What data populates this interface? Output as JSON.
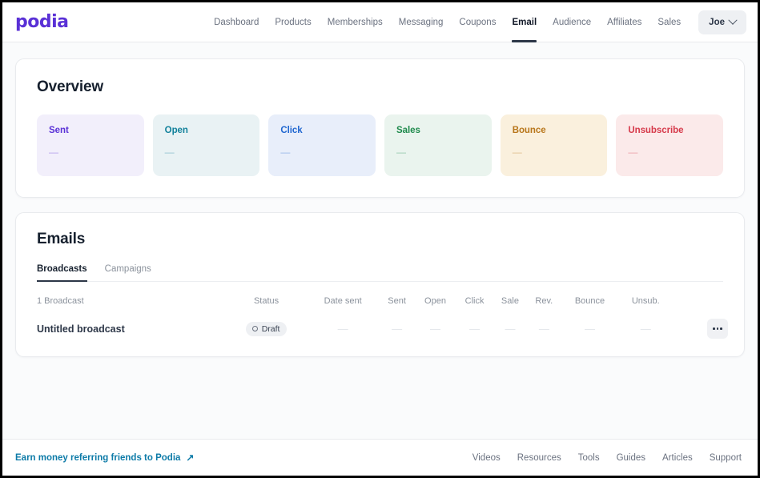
{
  "brand": {
    "logo_text": "podia",
    "logo_color": "#5a31d6"
  },
  "nav": {
    "items": [
      {
        "label": "Dashboard",
        "active": false
      },
      {
        "label": "Products",
        "active": false
      },
      {
        "label": "Memberships",
        "active": false
      },
      {
        "label": "Messaging",
        "active": false
      },
      {
        "label": "Coupons",
        "active": false
      },
      {
        "label": "Email",
        "active": true
      },
      {
        "label": "Audience",
        "active": false
      },
      {
        "label": "Affiliates",
        "active": false
      },
      {
        "label": "Sales",
        "active": false
      }
    ],
    "account": {
      "label": "Joe",
      "icon": "chevron-down-icon"
    }
  },
  "overview": {
    "title": "Overview",
    "cards": [
      {
        "label": "Sent",
        "value": "—",
        "bg": "#f2effb",
        "fg": "#5a31d6"
      },
      {
        "label": "Open",
        "value": "—",
        "bg": "#e9f2f4",
        "fg": "#11819b"
      },
      {
        "label": "Click",
        "value": "—",
        "bg": "#e8eefa",
        "fg": "#1f66d0"
      },
      {
        "label": "Sales",
        "value": "—",
        "bg": "#eaf4ee",
        "fg": "#1e8a4c"
      },
      {
        "label": "Bounce",
        "value": "—",
        "bg": "#faf0dd",
        "fg": "#b8761a"
      },
      {
        "label": "Unsubscribe",
        "value": "—",
        "bg": "#fbeaea",
        "fg": "#d6394a"
      }
    ]
  },
  "emails": {
    "title": "Emails",
    "tabs": [
      {
        "label": "Broadcasts",
        "active": true
      },
      {
        "label": "Campaigns",
        "active": false
      }
    ],
    "count_label": "1 Broadcast",
    "columns": [
      "Status",
      "Date sent",
      "Sent",
      "Open",
      "Click",
      "Sale",
      "Rev.",
      "Bounce",
      "Unsub."
    ],
    "rows": [
      {
        "name": "Untitled broadcast",
        "status": "Draft",
        "status_icon": "circle-outline-icon",
        "date_sent": "—",
        "sent": "—",
        "open": "—",
        "click": "—",
        "sale": "—",
        "rev": "—",
        "bounce": "—",
        "unsub": "—",
        "menu_icon": "ellipsis-icon"
      }
    ]
  },
  "footer": {
    "referral_text": "Earn money referring friends to Podia",
    "referral_icon": "↗",
    "links": [
      "Videos",
      "Resources",
      "Tools",
      "Guides",
      "Articles",
      "Support"
    ]
  }
}
